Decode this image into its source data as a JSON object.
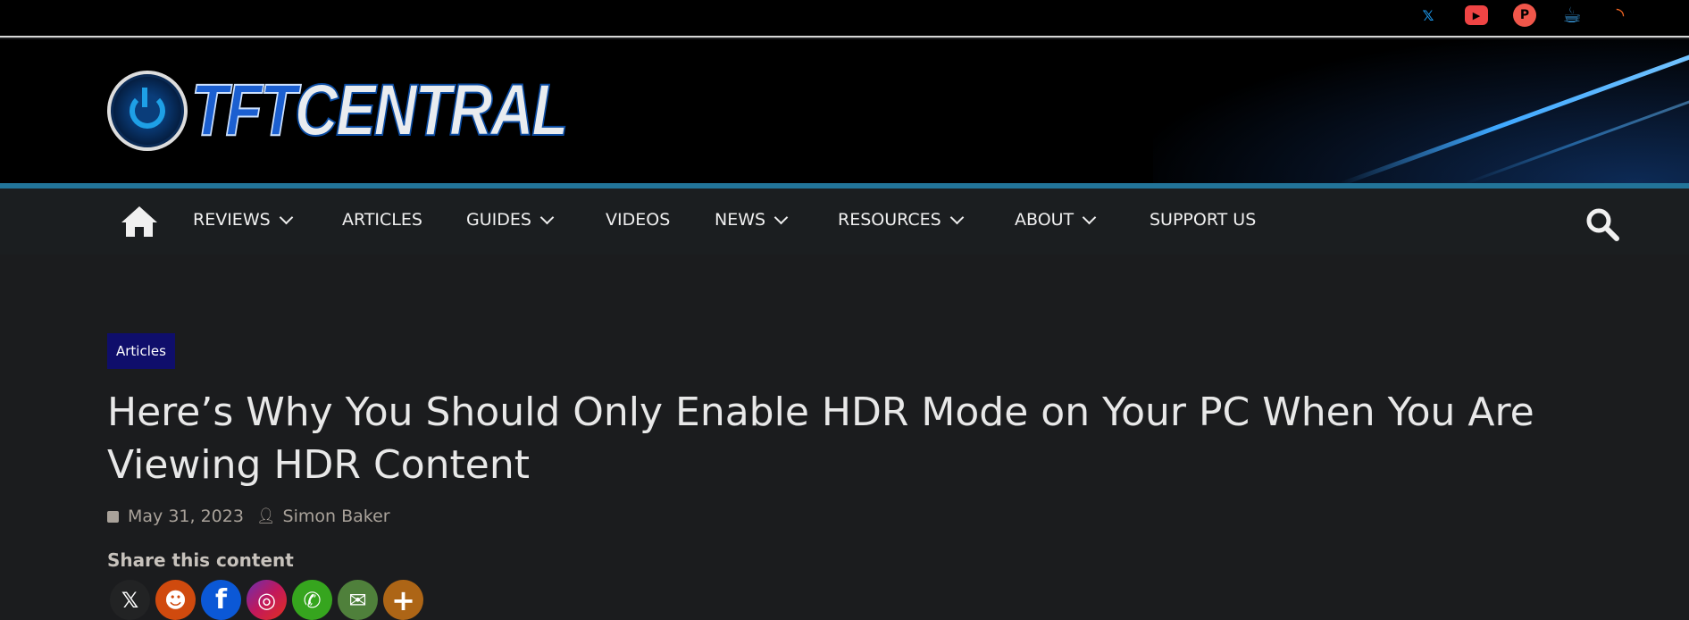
{
  "social_top": [
    {
      "name": "x",
      "glyph": "𝕏",
      "color": "#1d9bf0"
    },
    {
      "name": "youtube",
      "glyph": "▶",
      "color": "#ef4444"
    },
    {
      "name": "patreon",
      "glyph": "P",
      "color": "#f0564a"
    },
    {
      "name": "kofi",
      "glyph": "☕",
      "color": "#3ba0e6"
    },
    {
      "name": "rss",
      "glyph": ")",
      "color": "#f26522"
    }
  ],
  "logo": {
    "part1": "TFT",
    "part2": "CENTRAL"
  },
  "nav": {
    "items": [
      "REVIEWS",
      "ARTICLES",
      "GUIDES",
      "VIDEOS",
      "NEWS",
      "RESOURCES",
      "ABOUT",
      "SUPPORT US"
    ]
  },
  "article": {
    "category": "Articles",
    "title": "Here’s Why You Should Only Enable HDR Mode on Your PC When You Are Viewing HDR Content",
    "date": "May 31, 2023",
    "author": "Simon Baker",
    "share_label": "Share this content"
  },
  "share": [
    {
      "name": "x",
      "glyph": "𝕏",
      "color": "#222324"
    },
    {
      "name": "reddit",
      "glyph": "☻",
      "color": "#d04a0e"
    },
    {
      "name": "facebook",
      "glyph": "f",
      "color": "#0b58d6"
    },
    {
      "name": "instagram",
      "glyph": "◎",
      "color": "#b6225a"
    },
    {
      "name": "whatsapp",
      "glyph": "✆",
      "color": "#36a51e"
    },
    {
      "name": "email",
      "glyph": "✉",
      "color": "#4f803b"
    },
    {
      "name": "more",
      "glyph": "+",
      "color": "#ad6516"
    }
  ]
}
